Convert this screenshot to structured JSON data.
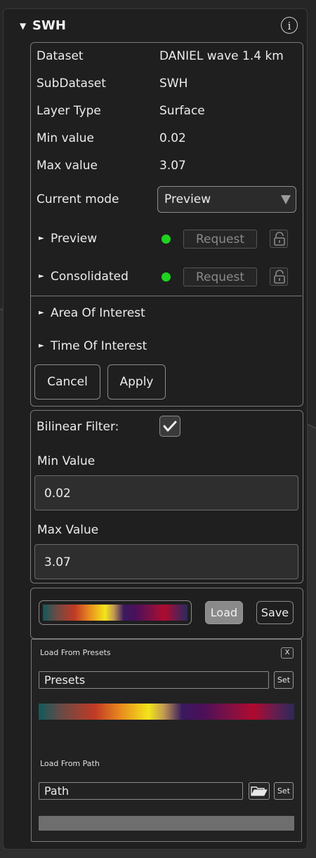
{
  "header": {
    "title": "SWH",
    "info_icon_glyph": "i"
  },
  "info": {
    "rows": [
      {
        "label": "Dataset",
        "value": "DANIEL wave 1.4 km"
      },
      {
        "label": "SubDataset",
        "value": "SWH"
      },
      {
        "label": "Layer Type",
        "value": "Surface"
      },
      {
        "label": "Min value",
        "value": "0.02"
      },
      {
        "label": "Max value",
        "value": "3.07"
      }
    ],
    "current_mode_label": "Current mode",
    "current_mode_value": "Preview",
    "preview": {
      "label": "Preview",
      "status_color": "#1ed31e",
      "request_label": "Request"
    },
    "consolidated": {
      "label": "Consolidated",
      "status_color": "#1ed31e",
      "request_label": "Request"
    },
    "area_of_interest": "Area Of Interest",
    "time_of_interest": "Time Of Interest",
    "cancel_label": "Cancel",
    "apply_label": "Apply"
  },
  "filter": {
    "bilinear_label": "Bilinear Filter:",
    "bilinear_checked": true,
    "min_label": "Min Value",
    "min_value": "0.02",
    "max_label": "Max Value",
    "max_value": "3.07"
  },
  "colormap": {
    "load_label": "Load",
    "save_label": "Save",
    "presets_title": "Load From Presets",
    "close_label": "X",
    "presets_value": "Presets",
    "set_label": "Set",
    "path_title": "Load From Path",
    "path_value": "Path",
    "path_set_label": "Set"
  },
  "colors": {
    "accent_green": "#1ed31e",
    "panel_bg": "#1f1f1f",
    "load_button_bg": "#8a8a8a"
  }
}
